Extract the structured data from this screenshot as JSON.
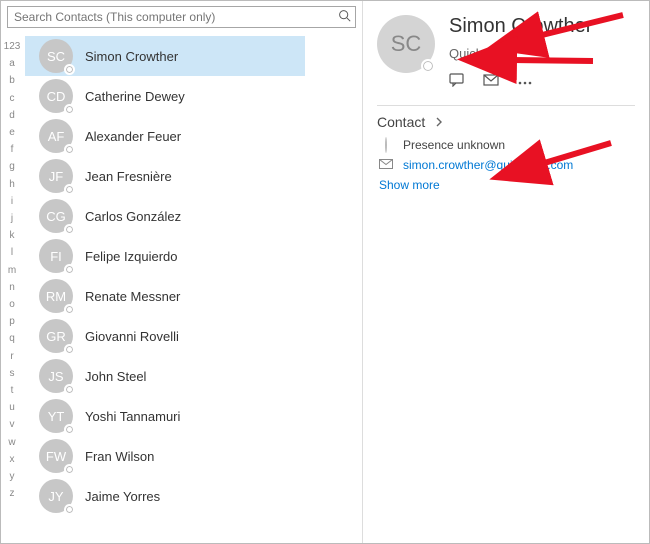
{
  "search": {
    "placeholder": "Search Contacts (This computer only)"
  },
  "alpha": [
    "123",
    "a",
    "b",
    "c",
    "d",
    "e",
    "f",
    "g",
    "h",
    "i",
    "j",
    "k",
    "l",
    "m",
    "n",
    "o",
    "p",
    "q",
    "r",
    "s",
    "t",
    "u",
    "v",
    "w",
    "x",
    "y",
    "z"
  ],
  "alpha_top": "123",
  "contacts": [
    {
      "initials": "SC",
      "name": "Simon Crowther",
      "selected": true
    },
    {
      "initials": "CD",
      "name": "Catherine Dewey",
      "selected": false
    },
    {
      "initials": "AF",
      "name": "Alexander Feuer",
      "selected": false
    },
    {
      "initials": "JF",
      "name": "Jean Fresnière",
      "selected": false
    },
    {
      "initials": "CG",
      "name": "Carlos González",
      "selected": false
    },
    {
      "initials": "FI",
      "name": "Felipe Izquierdo",
      "selected": false
    },
    {
      "initials": "RM",
      "name": "Renate Messner",
      "selected": false
    },
    {
      "initials": "GR",
      "name": "Giovanni Rovelli",
      "selected": false
    },
    {
      "initials": "JS",
      "name": "John Steel",
      "selected": false
    },
    {
      "initials": "YT",
      "name": "Yoshi Tannamuri",
      "selected": false
    },
    {
      "initials": "FW",
      "name": "Fran Wilson",
      "selected": false
    },
    {
      "initials": "JY",
      "name": "Jaime Yorres",
      "selected": false
    }
  ],
  "detail": {
    "initials": "SC",
    "name": "Simon Crowther",
    "company": "Quick-Stop",
    "section_label": "Contact",
    "presence_text": "Presence unknown",
    "email": "simon.crowther@quickstop.com",
    "show_more": "Show more"
  }
}
